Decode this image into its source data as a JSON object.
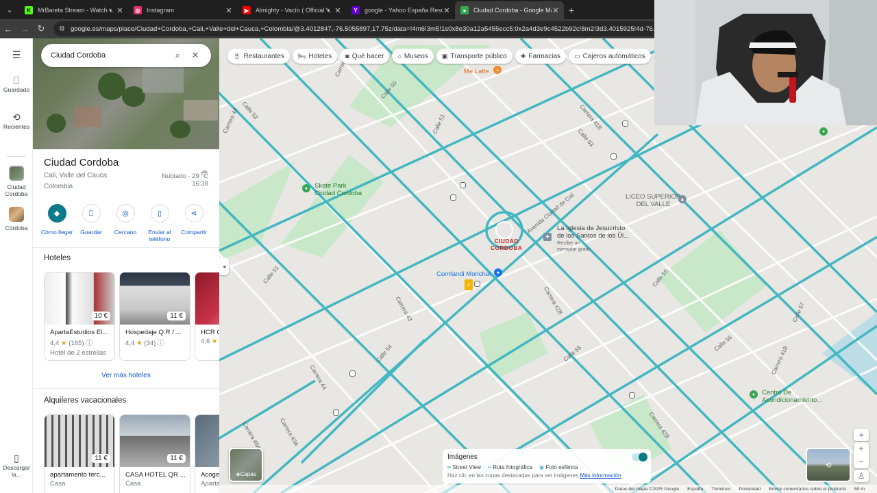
{
  "browser": {
    "tabs": [
      {
        "title": "MrBareta Stream - Watch Li",
        "favicon": "kick-icon",
        "color": "#53fc18",
        "active": false,
        "muted": true
      },
      {
        "title": "Instagram",
        "favicon": "instagram-icon",
        "color": "#e1306c",
        "active": false,
        "muted": false
      },
      {
        "title": "Almighty - Vacío ( Official Video",
        "favicon": "youtube-icon",
        "color": "#ff0000",
        "active": false,
        "muted": true
      },
      {
        "title": "google - Yahoo España Resultados",
        "favicon": "yahoo-icon",
        "color": "#6001d2",
        "active": false,
        "muted": false
      },
      {
        "title": "Ciudad Cordoba - Google Maps",
        "favicon": "maps-icon",
        "color": "#34a853",
        "active": true,
        "muted": false
      }
    ],
    "url": "google.es/maps/place/Ciudad+Cordoba,+Cali,+Valle+del+Cauca,+Colombia/@3.4012847,-76.5055897,17.75z/data=!4m6!3m5!1s0x8e30a12a5455ecc5:0x2a4d3e9c4522b92c!8m2!3d3.4015925!4d-76.5046581"
  },
  "rail": {
    "saved": "Guardado",
    "recent": "Recientes",
    "place1": "Ciudad Cordoba",
    "place2": "Córdoba",
    "download": "Descargar la..."
  },
  "panel": {
    "search_value": "Ciudad Cordoba",
    "title": "Ciudad Cordoba",
    "address1": "Cali, Valle del Cauca",
    "address2": "Colombia",
    "weather": "Nublado · 29 °C",
    "time": "16:38",
    "actions": [
      {
        "label": "Cómo llegar",
        "icon": "directions-icon"
      },
      {
        "label": "Guardar",
        "icon": "bookmark-icon"
      },
      {
        "label": "Cercano",
        "icon": "nearby-icon"
      },
      {
        "label": "Enviar al teléfono",
        "icon": "phone-icon"
      },
      {
        "label": "Compartir",
        "icon": "share-icon"
      }
    ],
    "hotels_title": "Hoteles",
    "hotels": [
      {
        "name": "ApartaEstudios El...",
        "price": "10 €",
        "rating": "4,4",
        "reviews": "(165)",
        "type": "Hotel de 2 estrellas"
      },
      {
        "name": "Hospedaje Q.R / ...",
        "price": "11 €",
        "rating": "4,4",
        "reviews": "(34)",
        "type": ""
      },
      {
        "name": "HCR C",
        "price": "",
        "rating": "4,6",
        "reviews": "",
        "type": ""
      }
    ],
    "more_hotels": "Ver más hoteles",
    "rentals_title": "Alquileres vacacionales",
    "rentals": [
      {
        "name": "apartamento terc...",
        "price": "11 €",
        "type": "Casa"
      },
      {
        "name": "CASA HOTEL QR ...",
        "price": "11 €",
        "type": "Casa"
      },
      {
        "name": "Acoge",
        "price": "",
        "type": "Aparta"
      }
    ]
  },
  "map": {
    "chips": [
      {
        "label": "Restaurantes",
        "icon": "fork-icon"
      },
      {
        "label": "Hoteles",
        "icon": "bed-icon"
      },
      {
        "label": "Qué hacer",
        "icon": "camera-icon"
      },
      {
        "label": "Museos",
        "icon": "museum-icon"
      },
      {
        "label": "Transporte público",
        "icon": "bus-icon"
      },
      {
        "label": "Farmacias",
        "icon": "pharmacy-icon"
      },
      {
        "label": "Cajeros automáticos",
        "icon": "atm-icon"
      }
    ],
    "place_name_1": "CIUDAD",
    "place_name_2": "CORDOBA",
    "poi": {
      "me_latte": "Me Latte",
      "skate_1": "Skate Park",
      "skate_2": "Ciudad Cordoba",
      "comfandi": "Comfandi Morichal",
      "liceo_1": "LICEO SUPERIOR",
      "liceo_2": "DEL VALLE",
      "iglesia_1": "La Iglesia de Jesucristo",
      "iglesia_2": "de los Santos de los Úl...",
      "iglesia_3": "Recibe un",
      "iglesia_4": "ejemplar gratis",
      "centro_1": "Centro De",
      "centro_2": "Acondicionamiento..."
    },
    "streets": {
      "s1": "Carrera 42B",
      "s2": "Calle 50",
      "s3": "Calle 51",
      "s4": "Carrera 41B",
      "s5": "Carrera 43",
      "s6": "Calle 52",
      "s7": "Avenida Ciudad de Cali",
      "s8": "Calle 51",
      "s9": "Carrera 43",
      "s10": "Calle 54",
      "s11": "Carrera 44",
      "s12": "Carrera 42B",
      "s13": "Calle 55",
      "s14": "Carrera 42B",
      "s15": "Calle 56",
      "s16": "Carrera 41B",
      "s17": "Calle 57",
      "s18": "Calle 45A",
      "s19": "Carrera 43A",
      "s20": "Carrera 45A",
      "s21": "Calle 53",
      "s22": "Calle 55"
    },
    "imagenes_title": "Imágenes",
    "legend_sv": "Street View",
    "legend_ruta": "Ruta fotográfica",
    "legend_esf": "Foto esférica",
    "imagenes_hint": "Haz clic en las zonas destacadas para ver imágenes",
    "imagenes_link": "Más información",
    "layers_label": "Capas",
    "footer": [
      "Datos del mapa ©2025 Google",
      "España",
      "Términos",
      "Privacidad",
      "Enviar comentarios sobre el producto",
      "50 m"
    ]
  },
  "colors": {
    "road": "#42b7c2",
    "accent": "#0b7a8c",
    "park": "#c8e6c9"
  }
}
